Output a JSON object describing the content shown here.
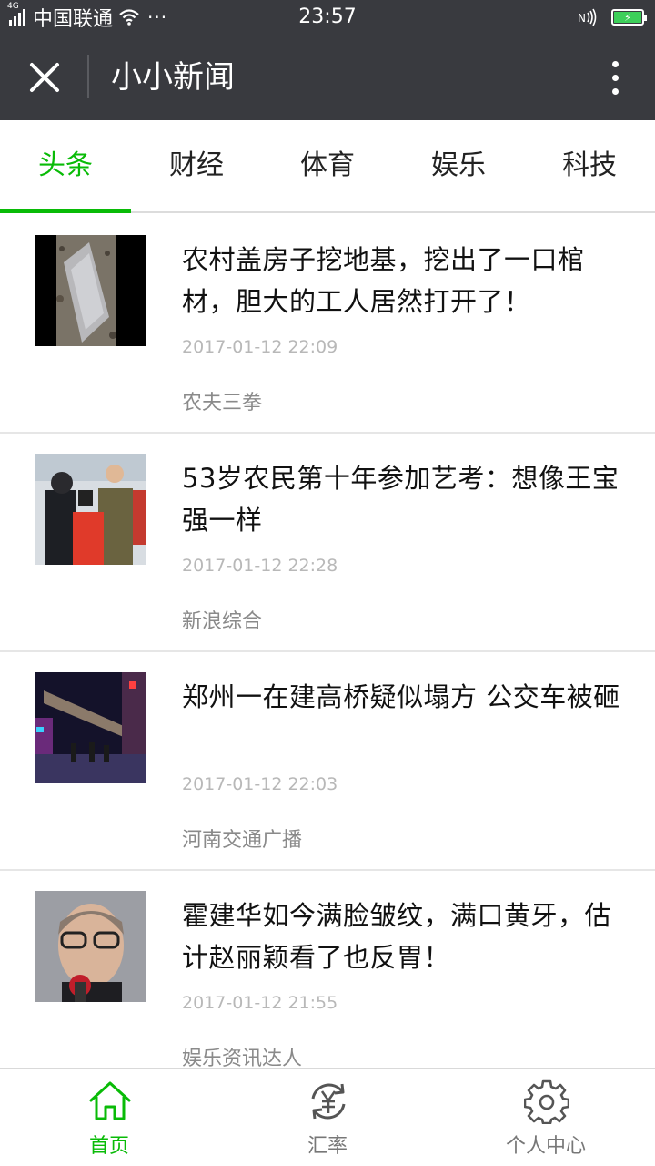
{
  "status_bar": {
    "network_type": "4G",
    "carrier": "中国联通",
    "more": "···",
    "time": "23:57"
  },
  "title_bar": {
    "title": "小小新闻",
    "close_icon": "close-icon",
    "more_icon": "more-vertical-icon"
  },
  "tabs": [
    {
      "label": "头条",
      "active": true
    },
    {
      "label": "财经",
      "active": false
    },
    {
      "label": "体育",
      "active": false
    },
    {
      "label": "娱乐",
      "active": false
    },
    {
      "label": "科技",
      "active": false
    }
  ],
  "news": [
    {
      "title": "农村盖房子挖地基，挖出了一口棺材，胆大的工人居然打开了！",
      "time": "2017-01-12 22:09",
      "source": "农夫三拳",
      "thumb": "coffin-photo"
    },
    {
      "title": "53岁农民第十年参加艺考：想像王宝强一样",
      "time": "2017-01-12 22:28",
      "source": "新浪综合",
      "thumb": "exam-photo"
    },
    {
      "title": "郑州一在建高桥疑似塌方 公交车被砸",
      "time": "2017-01-12 22:03",
      "source": "河南交通广播",
      "thumb": "bridge-photo"
    },
    {
      "title": "霍建华如今满脸皱纹，满口黄牙，估计赵丽颖看了也反胃！",
      "time": "2017-01-12 21:55",
      "source": "娱乐资讯达人",
      "thumb": "portrait-photo"
    }
  ],
  "bottom_nav": [
    {
      "label": "首页",
      "icon": "home-icon",
      "active": true
    },
    {
      "label": "汇率",
      "icon": "exchange-rate-icon",
      "active": false
    },
    {
      "label": "个人中心",
      "icon": "gear-icon",
      "active": false
    }
  ],
  "colors": {
    "header_bg": "#393a3f",
    "accent": "#09bb07",
    "battery": "#3dcf5a"
  }
}
